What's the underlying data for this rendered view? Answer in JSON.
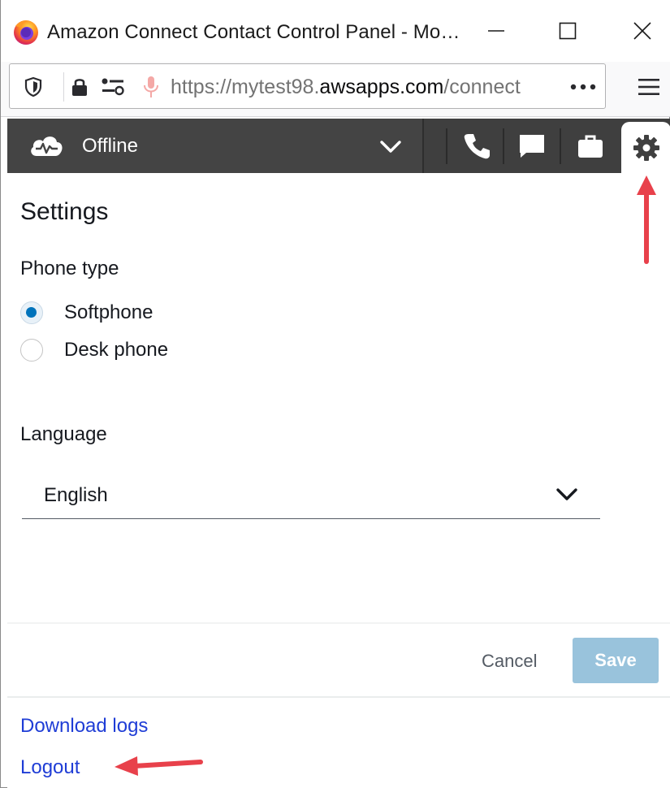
{
  "window": {
    "title": "Amazon Connect Contact Control Panel - Mo…",
    "controls": [
      "minimize",
      "maximize",
      "close"
    ]
  },
  "urlbar": {
    "url_prefix": "https://mytest98.",
    "url_host": "awsapps.com",
    "url_suffix": "/connect",
    "more_glyph": "•••"
  },
  "ccp": {
    "status": "Offline",
    "tabs": [
      "phone",
      "chat",
      "cases",
      "settings"
    ],
    "active_tab": "settings"
  },
  "settings": {
    "title": "Settings",
    "phone_type_label": "Phone type",
    "phone_options": [
      {
        "label": "Softphone",
        "selected": true
      },
      {
        "label": "Desk phone",
        "selected": false
      }
    ],
    "language_label": "Language",
    "language_value": "English",
    "cancel_label": "Cancel",
    "save_label": "Save",
    "download_logs_label": "Download logs",
    "logout_label": "Logout"
  },
  "colors": {
    "header_bg": "#3f3f3f",
    "radio_accent": "#0073bb",
    "save_disabled": "#99c3dc",
    "link": "#1f3dd6",
    "annotation_arrow": "#e8414b"
  }
}
